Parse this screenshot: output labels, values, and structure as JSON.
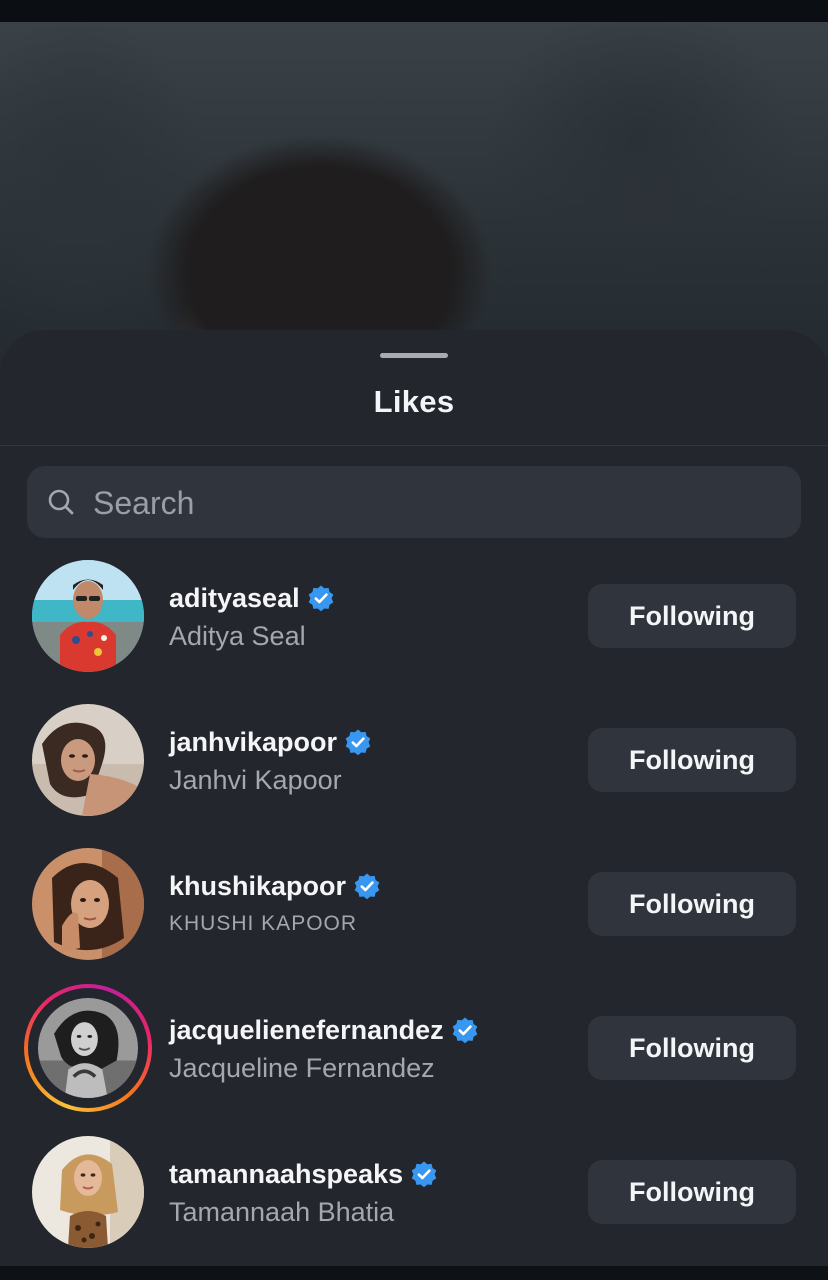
{
  "sheet": {
    "title": "Likes"
  },
  "search": {
    "placeholder": "Search"
  },
  "users": [
    {
      "username": "adityaseal",
      "full_name": "Aditya Seal",
      "verified": true,
      "button_label": "Following",
      "has_story": false
    },
    {
      "username": "janhvikapoor",
      "full_name": "Janhvi Kapoor",
      "verified": true,
      "button_label": "Following",
      "has_story": false
    },
    {
      "username": "khushikapoor",
      "full_name": "KHUSHI KAPOOR",
      "verified": true,
      "button_label": "Following",
      "has_story": false
    },
    {
      "username": "jacquelienefernandez",
      "full_name": "Jacqueline Fernandez",
      "verified": true,
      "button_label": "Following",
      "has_story": true
    },
    {
      "username": "tamannaahspeaks",
      "full_name": "Tamannaah Bhatia",
      "verified": true,
      "button_label": "Following",
      "has_story": false
    }
  ],
  "colors": {
    "sheet_bg": "#23262d",
    "button_bg": "#30343c",
    "verified_blue": "#3897f0",
    "story_ring": [
      "#f9c33a",
      "#e8256a",
      "#c1209b"
    ]
  },
  "icons": {
    "search": "search-icon",
    "verified": "verified-badge-icon"
  }
}
